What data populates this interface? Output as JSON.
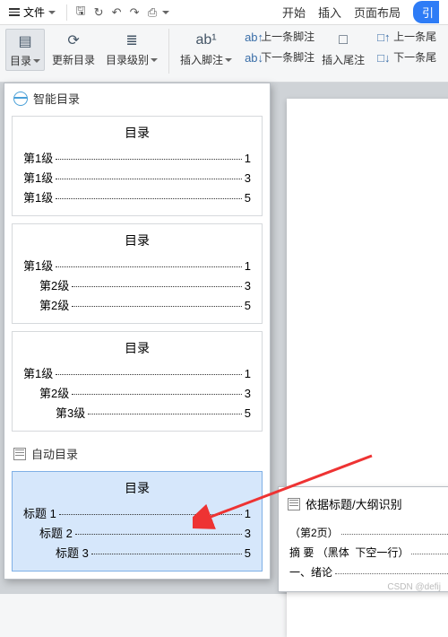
{
  "menubar": {
    "file": "文件",
    "tabs": {
      "start": "开始",
      "insert": "插入",
      "layout": "页面布局",
      "cite": "引"
    }
  },
  "toolbar": {
    "toc": "目录",
    "update": "更新目录",
    "level": "目录级别",
    "footnote": "插入脚注",
    "prev_footnote": "上一条脚注",
    "next_footnote": "下一条脚注",
    "endnote": "插入尾注",
    "prev_endnote": "上一条尾",
    "next_endnote": "下一条尾"
  },
  "dropdown": {
    "smart_header": "智能目录",
    "auto_header": "自动目录",
    "title": "目录",
    "level1": "第1级",
    "level2": "第2级",
    "level3": "第3级",
    "heading1": "标题 1",
    "heading2": "标题 2",
    "heading3": "标题 3",
    "p1": "1",
    "p3": "3",
    "p5": "5"
  },
  "panel": {
    "header": "依据标题/大纲识别",
    "line1_a": "（第2页）",
    "line2_a": "摘 要",
    "line2_b": "（黑体",
    "line2_c": "下空一行）",
    "line3_a": "一、绪论"
  },
  "watermark": "CSDN @defij"
}
